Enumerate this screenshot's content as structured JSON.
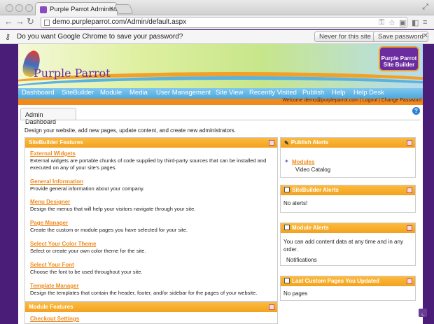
{
  "browser": {
    "tab_title": "Purple Parrot Administratio",
    "url": "demo.purpleparrot.com/Admin/default.aspx",
    "password_prompt": "Do you want Google Chrome to save your password?",
    "never_label": "Never for this site",
    "save_label": "Save password"
  },
  "site": {
    "logo_text": "Purple Parrot",
    "sitebuilder_logo": "Purple Parrot Site Builder",
    "menu": [
      "Dashboard",
      "SiteBuilder",
      "Module",
      "Media",
      "User Management",
      "Site View",
      "Recently Visited",
      "Publish",
      "Help",
      "Help Desk"
    ],
    "welcome": "Welcome demo@purpleparrot.com | Logout | Change Password"
  },
  "dashboard": {
    "tab": "Admin Dashboard",
    "intro": "Design your website, add new pages, update content, and create new administrators.",
    "sitebuilder_features": {
      "title": "SiteBuilder Features",
      "items": [
        {
          "link": "External Widgets",
          "desc": "External widgets are portable chunks of code supplied by third-party sources that can be installed and executed on any of your site's pages."
        },
        {
          "link": "General Information",
          "desc": "Provide general information about your company."
        },
        {
          "link": "Menu Designer",
          "desc": "Design the menus that will help your visitors navigate through your site."
        },
        {
          "link": "Page Manager",
          "desc": "Create the custom or module pages you have selected for your site."
        },
        {
          "link": "Select Your Color Theme",
          "desc": "Select or create your own color theme for the site."
        },
        {
          "link": "Select Your Font",
          "desc": "Choose the font to be used throughout your site."
        },
        {
          "link": "Template Manager",
          "desc": "Design the templates that contain the header, footer, and/or sidebar for the pages of your website."
        }
      ]
    },
    "module_features": {
      "title": "Module Features",
      "items": [
        {
          "link": "Checkout Settings"
        }
      ]
    },
    "publish_alerts": {
      "title": "Publish Alerts",
      "link": "Modules",
      "item": "Video Catalog"
    },
    "sitebuilder_alerts": {
      "title": "SiteBuilder Alerts",
      "text": "No alerts!"
    },
    "module_alerts": {
      "title": "Module Alerts",
      "text": "You can add content data at any time and in any order.",
      "item": "Notifications"
    },
    "last_pages": {
      "title": "Last Custom Pages You Updated",
      "text": "No pages"
    }
  }
}
